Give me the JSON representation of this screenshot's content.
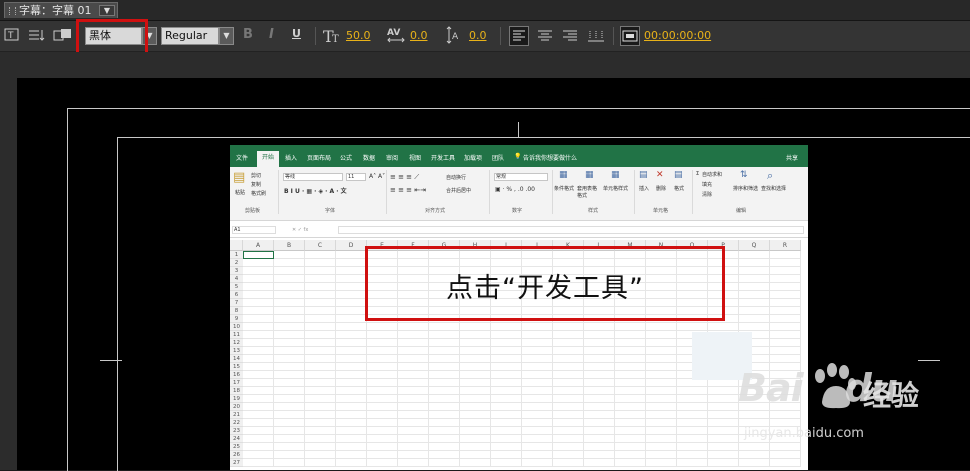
{
  "panel": {
    "tab_title": "字幕：字幕 01",
    "menu_glyph": "▼"
  },
  "toolbar": {
    "font_family": "黑体",
    "font_style": "Regular",
    "bold": "B",
    "italic": "I",
    "underline": "U",
    "font_size": "50.0",
    "kerning": "0.0",
    "leading": "0.0",
    "timecode": "00:00:00:00"
  },
  "excel": {
    "tabs": [
      "文件",
      "开始",
      "插入",
      "页面布局",
      "公式",
      "数据",
      "审阅",
      "视图",
      "开发工具",
      "加载项",
      "团队"
    ],
    "active_tab": "开始",
    "tell_me": "告诉我你想要做什么",
    "share": "共享",
    "ribbon": {
      "clipboard": {
        "cut": "剪切",
        "copy": "复制",
        "format_painter": "格式刷",
        "paste": "粘贴",
        "group": "剪贴板"
      },
      "font": {
        "name": "等线",
        "size": "11",
        "group": "字体"
      },
      "alignment": {
        "wrap": "自动换行",
        "merge": "合并后居中",
        "group": "对齐方式"
      },
      "number": {
        "format": "常规",
        "group": "数字"
      },
      "styles": {
        "conditional": "条件格式",
        "table": "套用表格格式",
        "cell": "单元格样式",
        "group": "样式"
      },
      "cells": {
        "insert": "插入",
        "delete": "删除",
        "format": "格式",
        "group": "单元格"
      },
      "editing": {
        "autosum": "自动求和",
        "fill": "填充",
        "clear": "清除",
        "sort": "排序和筛选",
        "find": "查找和选择",
        "group": "编辑"
      }
    },
    "name_box": "A1",
    "columns": [
      "A",
      "B",
      "C",
      "D",
      "E",
      "F",
      "G",
      "H",
      "I",
      "J",
      "K",
      "L",
      "M",
      "N",
      "O",
      "P",
      "Q",
      "R"
    ],
    "rows": [
      "1",
      "2",
      "3",
      "4",
      "5",
      "6",
      "7",
      "8",
      "9",
      "10",
      "11",
      "12",
      "13",
      "14",
      "15",
      "16",
      "17",
      "18",
      "19",
      "20",
      "21",
      "22",
      "23",
      "24",
      "25",
      "26",
      "27"
    ]
  },
  "callout": {
    "text": "点击“开发工具”"
  },
  "watermark": {
    "logo": "Bai",
    "logo_du": "du",
    "brand": "经验",
    "url": "jingyan.baidu.com"
  },
  "colors": {
    "accent_value": "#e8b219",
    "excel_green": "#217346",
    "highlight_red": "#d01010"
  }
}
